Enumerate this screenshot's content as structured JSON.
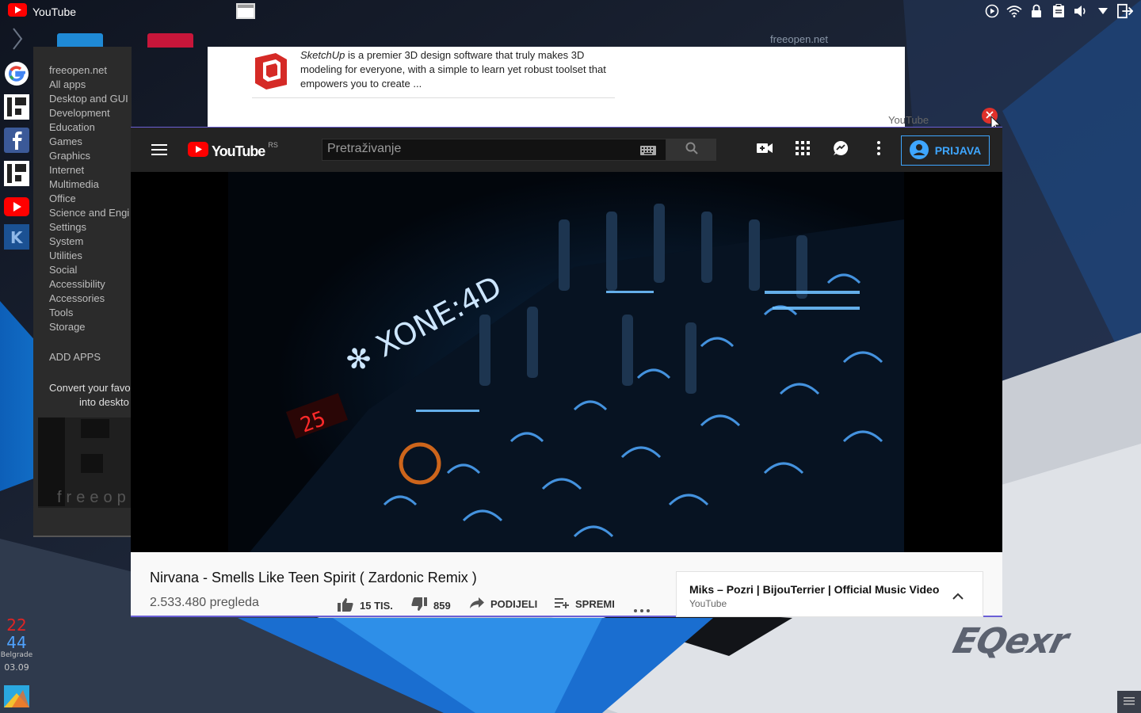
{
  "top_panel": {
    "app_title": "YouTube"
  },
  "watermark": {
    "site": "freeopen.net",
    "tab_label": "YouTube"
  },
  "app_menu": {
    "items": [
      "freeopen.net",
      "All apps",
      "Desktop and GUI",
      "Development",
      "Education",
      "Games",
      "Graphics",
      "Internet",
      "Multimedia",
      "Office",
      "Science and Engi",
      "Settings",
      "System",
      "Utilities",
      "Social",
      "Accessibility",
      "Accessories",
      "Tools",
      "Storage"
    ],
    "add_apps": "ADD APPS",
    "convert_line1": "Convert your favo",
    "convert_line2": "into deskto",
    "logo_text": "freeop"
  },
  "sketchup": {
    "name": "SketchUp",
    "desc": " is a premier 3D design software that truly makes 3D modeling for everyone, with a simple to learn yet robust toolset that empowers you to create ..."
  },
  "youtube": {
    "logo": "YouTube",
    "region": "RS",
    "search_placeholder": "Pretraživanje",
    "signin_label": "PRIJAVA",
    "video_title": "Nirvana - Smells Like Teen Spirit ( Zardonic Remix )",
    "views": "2.533.480 pregleda",
    "likes": "15 TIS.",
    "dislikes": "859",
    "share": "PODIJELI",
    "save": "SPREMI",
    "next": {
      "title": "Miks – Pozri | BijouTerrier | Official Music Video",
      "channel": "YouTube"
    }
  },
  "clock": {
    "hour": "22",
    "minute": "44",
    "city": "Belgrade",
    "date": "03.09"
  },
  "wallpaper_brand": "EQexr",
  "colors": {
    "youtube_red": "#ff0000",
    "accent_blue": "#3ea6ff",
    "window_border": "#6b5fd6"
  }
}
